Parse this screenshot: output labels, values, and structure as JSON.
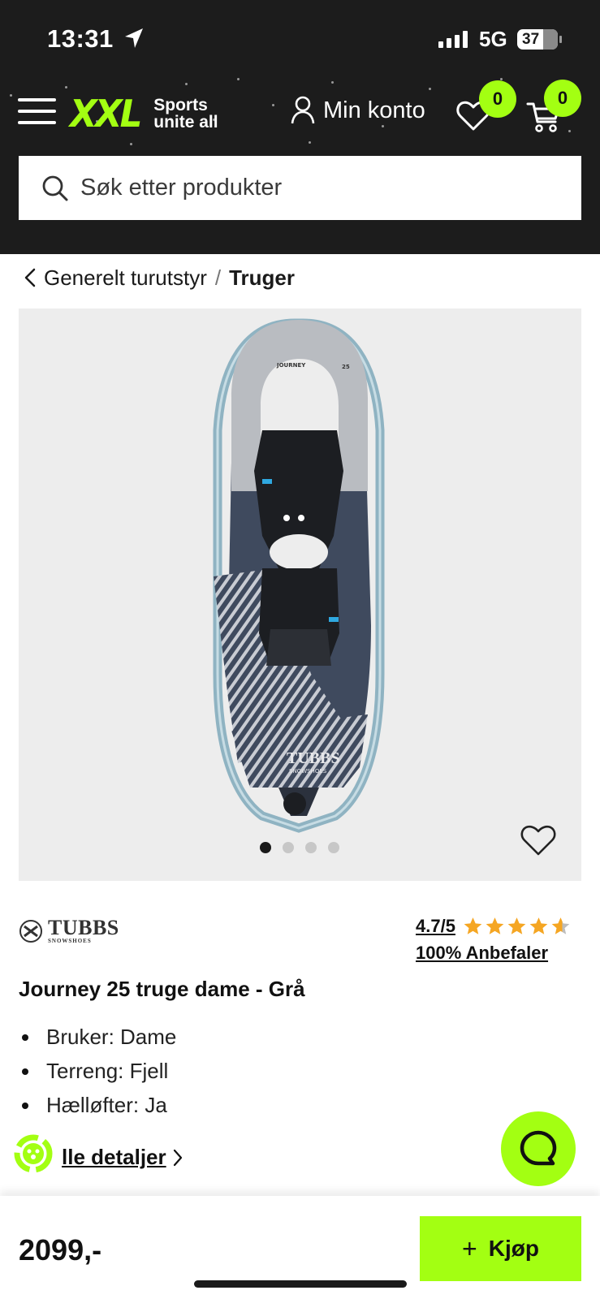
{
  "status_bar": {
    "time": "13:31",
    "network": "5G",
    "battery": "37"
  },
  "header": {
    "logo_main": "XXL",
    "logo_tagline_1": "Sports",
    "logo_tagline_2": "unite all",
    "account_label": "Min konto",
    "wishlist_count": "0",
    "cart_count": "0",
    "brand_color": "#a3ff12"
  },
  "search": {
    "placeholder": "Søk etter produkter"
  },
  "breadcrumb": {
    "parent": "Generelt turutstyr",
    "separator": "/",
    "current": "Truger"
  },
  "gallery": {
    "image_count": 4,
    "active_index": 0,
    "product_print_model": "JOURNEY",
    "product_print_size": "25",
    "product_print_brand": "TUBBS",
    "product_print_sub": "SNOWSHOES"
  },
  "product": {
    "brand_name": "TUBBS",
    "brand_sub": "SNOWSHOES",
    "rating": "4.7/5",
    "rating_value": 4.7,
    "recommend": "100% Anbefaler",
    "title": "Journey 25 truge dame - Grå",
    "features": [
      "Bruker: Dame",
      "Terreng: Fjell",
      "Hælløfter: Ja"
    ],
    "details_link": "lle detaljer"
  },
  "bottom_bar": {
    "price": "2099,-",
    "buy_label": "Kjøp"
  }
}
